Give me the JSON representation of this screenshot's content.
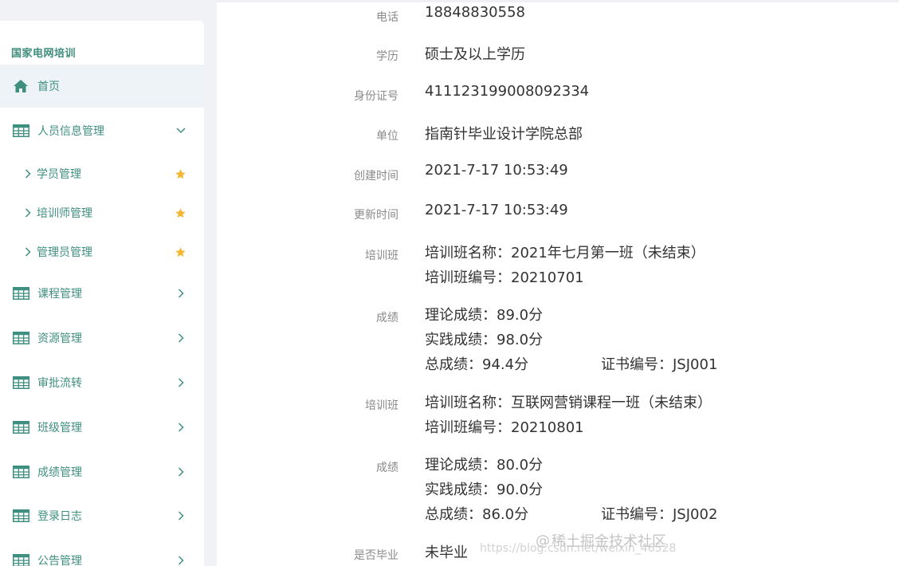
{
  "sidebar": {
    "brand": "国家电网培训",
    "home": "首页",
    "personnel": "人员信息管理",
    "sub_items": [
      "学员管理",
      "培训师管理",
      "管理员管理"
    ],
    "menu": [
      "课程管理",
      "资源管理",
      "审批流转",
      "班级管理",
      "成绩管理",
      "登录日志",
      "公告管理"
    ]
  },
  "detail": {
    "phone_label": "电话",
    "phone": "18848830558",
    "education_label": "学历",
    "education": "硕士及以上学历",
    "id_label": "身份证号",
    "id_number": "411123199008092334",
    "org_label": "单位",
    "org": "指南针毕业设计学院总部",
    "created_label": "创建时间",
    "created": "2021-7-17 10:53:49",
    "updated_label": "更新时间",
    "updated": "2021-7-17 10:53:49",
    "classes": [
      {
        "class_label": "培训班",
        "name_line": "培训班名称：2021年七月第一班（未结束）",
        "code_line": "培训班编号：20210701",
        "score_label": "成绩",
        "theory": "理论成绩：89.0分",
        "practice": "实践成绩：98.0分",
        "total": "总成绩：94.4分",
        "cert": "证书编号：JSJ001"
      },
      {
        "class_label": "培训班",
        "name_line": "培训班名称：互联网营销课程一班（未结束）",
        "code_line": "培训班编号：20210801",
        "score_label": "成绩",
        "theory": "理论成绩：80.0分",
        "practice": "实践成绩：90.0分",
        "total": "总成绩：86.0分",
        "cert": "证书编号：JSJ002"
      }
    ],
    "graduated_label": "是否毕业",
    "graduated": "未毕业"
  },
  "watermark": {
    "url": "https://blog.csdn.net/weixin_46528",
    "at": "@",
    "text": "稀土掘金技术社区"
  },
  "colors": {
    "accent": "#3f8f80",
    "star": "#f5b731",
    "active_bg": "#eef3f7"
  }
}
